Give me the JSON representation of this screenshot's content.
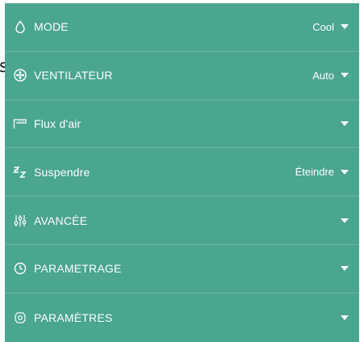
{
  "colors": {
    "panel_background": "#4aa591",
    "divider": "#6bb8a6",
    "text": "#ffffff"
  },
  "stray_glyph": "s",
  "menu": {
    "items": [
      {
        "id": "mode",
        "label": "MODE",
        "value": "Cool",
        "icon": "droplet-icon"
      },
      {
        "id": "ventilateur",
        "label": "VENTILATEUR",
        "value": "Auto",
        "icon": "fan-icon"
      },
      {
        "id": "flux",
        "label": "Flux d'air",
        "value": "",
        "icon": "airflow-icon"
      },
      {
        "id": "suspendre",
        "label": "Suspendre",
        "value": "Éteindre",
        "icon": "sleep-icon"
      },
      {
        "id": "avancee",
        "label": "AVANCÉE",
        "value": "",
        "icon": "sliders-icon"
      },
      {
        "id": "parametrage",
        "label": "PARAMETRAGE",
        "value": "",
        "icon": "clock-icon"
      },
      {
        "id": "parametres",
        "label": "PARAMÈTRES",
        "value": "",
        "icon": "gear-icon"
      }
    ]
  }
}
